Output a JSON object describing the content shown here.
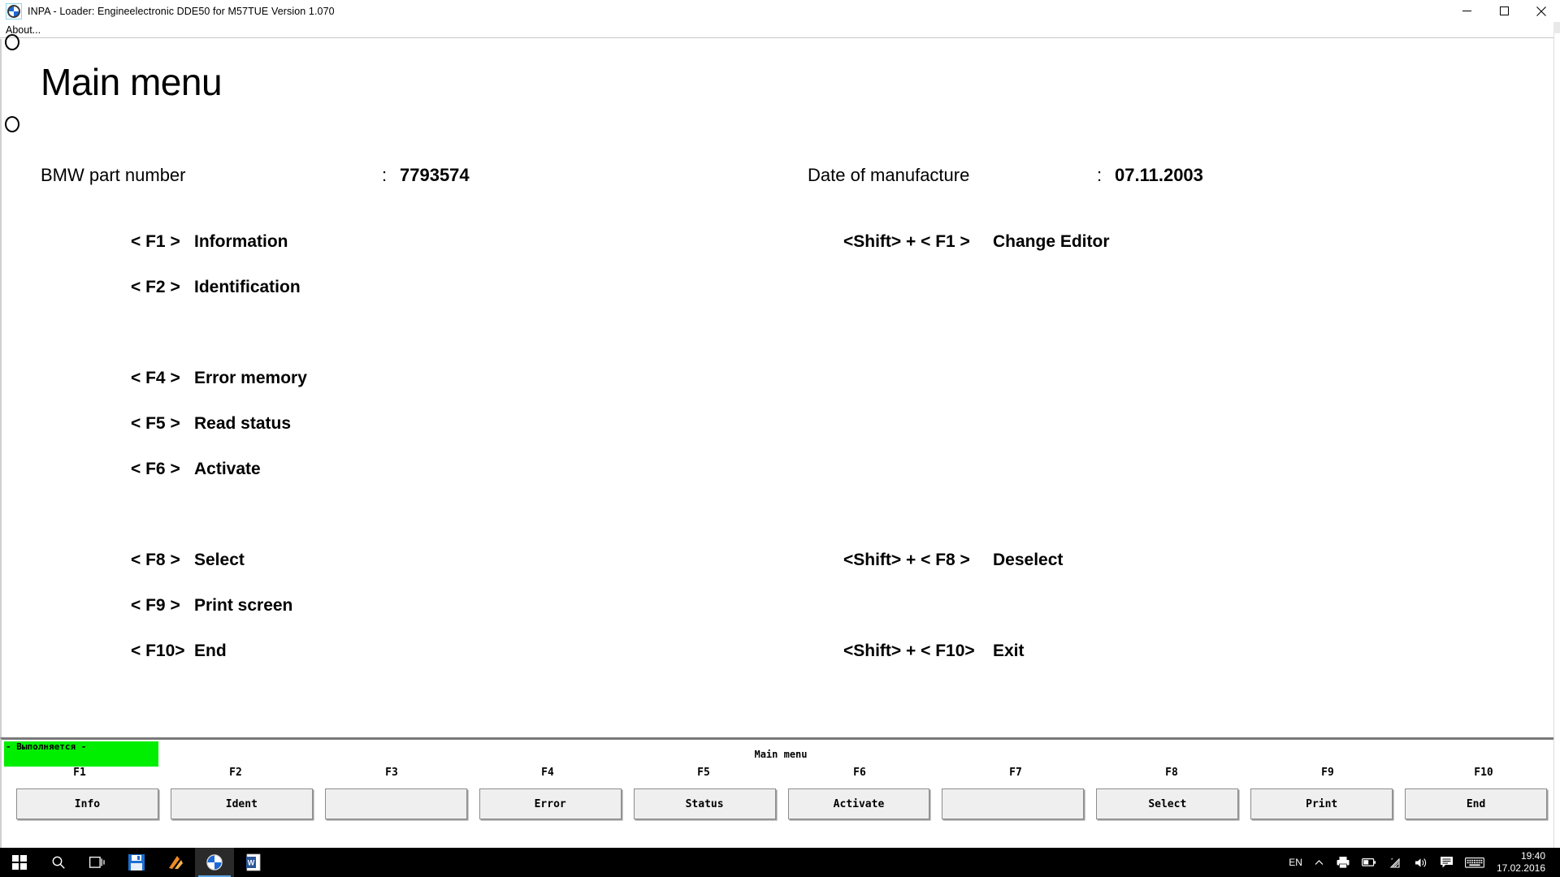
{
  "window": {
    "title": "INPA - Loader:  Engineelectronic DDE50 for M57TUE Version 1.070",
    "app_icon": "bmw-roundel-icon",
    "minimize_label": "─",
    "maximize_label": "□",
    "close_label": "✕"
  },
  "menubar": {
    "items": [
      {
        "label": "About..."
      }
    ]
  },
  "page": {
    "title": "Main menu",
    "fields": [
      {
        "label": "BMW part number",
        "separator": ":",
        "value": "7793574"
      },
      {
        "label": "Date of manufacture",
        "separator": ":",
        "value": "07.11.2003"
      }
    ],
    "left_menu": [
      {
        "key": "< F1 >",
        "label": "Information"
      },
      {
        "key": "< F2 >",
        "label": "Identification"
      },
      {
        "key": "< F4 >",
        "label": "Error memory"
      },
      {
        "key": "< F5 >",
        "label": "Read status"
      },
      {
        "key": "< F6 >",
        "label": "Activate"
      },
      {
        "key": "< F8 >",
        "label": "Select"
      },
      {
        "key": "< F9 >",
        "label": "Print screen"
      },
      {
        "key": "< F10>",
        "label": "End"
      }
    ],
    "right_menu": [
      {
        "key": "<Shift> + < F1 >",
        "label": "Change Editor"
      },
      {
        "key": "<Shift> + < F8 >",
        "label": "Deselect"
      },
      {
        "key": "<Shift> + < F10>",
        "label": "Exit"
      }
    ]
  },
  "status": {
    "progress_text": "- Выполняется -",
    "progress_color": "#00ee00",
    "center_label": "Main menu"
  },
  "function_bar": {
    "keys": [
      "F1",
      "F2",
      "F3",
      "F4",
      "F5",
      "F6",
      "F7",
      "F8",
      "F9",
      "F10"
    ],
    "buttons": [
      "Info",
      "Ident",
      "",
      "Error",
      "Status",
      "Activate",
      "",
      "Select",
      "Print",
      "End"
    ]
  },
  "taskbar": {
    "start": "windows-start-icon",
    "items": [
      {
        "icon": "search-icon",
        "name": "search"
      },
      {
        "icon": "task-view-icon",
        "name": "task-view"
      },
      {
        "icon": "floppy-save-icon",
        "name": "app-floppy"
      },
      {
        "icon": "orange-app-icon",
        "name": "app-orange"
      },
      {
        "icon": "bmw-inpa-icon",
        "name": "app-inpa"
      },
      {
        "icon": "word-icon",
        "name": "app-word"
      }
    ],
    "tray": {
      "language": "EN",
      "icons": [
        "chevron-up-icon",
        "printer-icon",
        "battery-icon",
        "wifi-icon",
        "volume-icon",
        "action-center-icon",
        "keyboard-icon"
      ]
    },
    "clock": {
      "time": "19:40",
      "date": "17.02.2016"
    }
  }
}
